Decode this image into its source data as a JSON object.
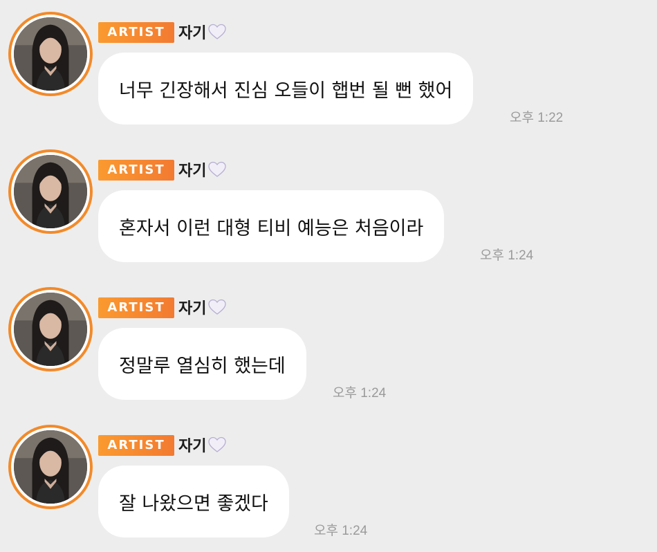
{
  "chat": {
    "artist_badge": "ARTIST",
    "sender_name": "자기",
    "colors": {
      "background": "#ededed",
      "badge": "#f58a30",
      "avatar_ring": "#f28a2a",
      "bubble": "#ffffff",
      "time": "#9a9a9a"
    },
    "messages": [
      {
        "text": "너무 긴장해서 진심 오들이 햅번 될 뻔 했어",
        "time": "오후 1:22"
      },
      {
        "text": "혼자서 이런 대형 티비 예능은 처음이라",
        "time": "오후 1:24"
      },
      {
        "text": "정말루 열심히 했는데",
        "time": "오후 1:24"
      },
      {
        "text": "잘 나왔으면 좋겠다",
        "time": "오후 1:24"
      }
    ]
  }
}
